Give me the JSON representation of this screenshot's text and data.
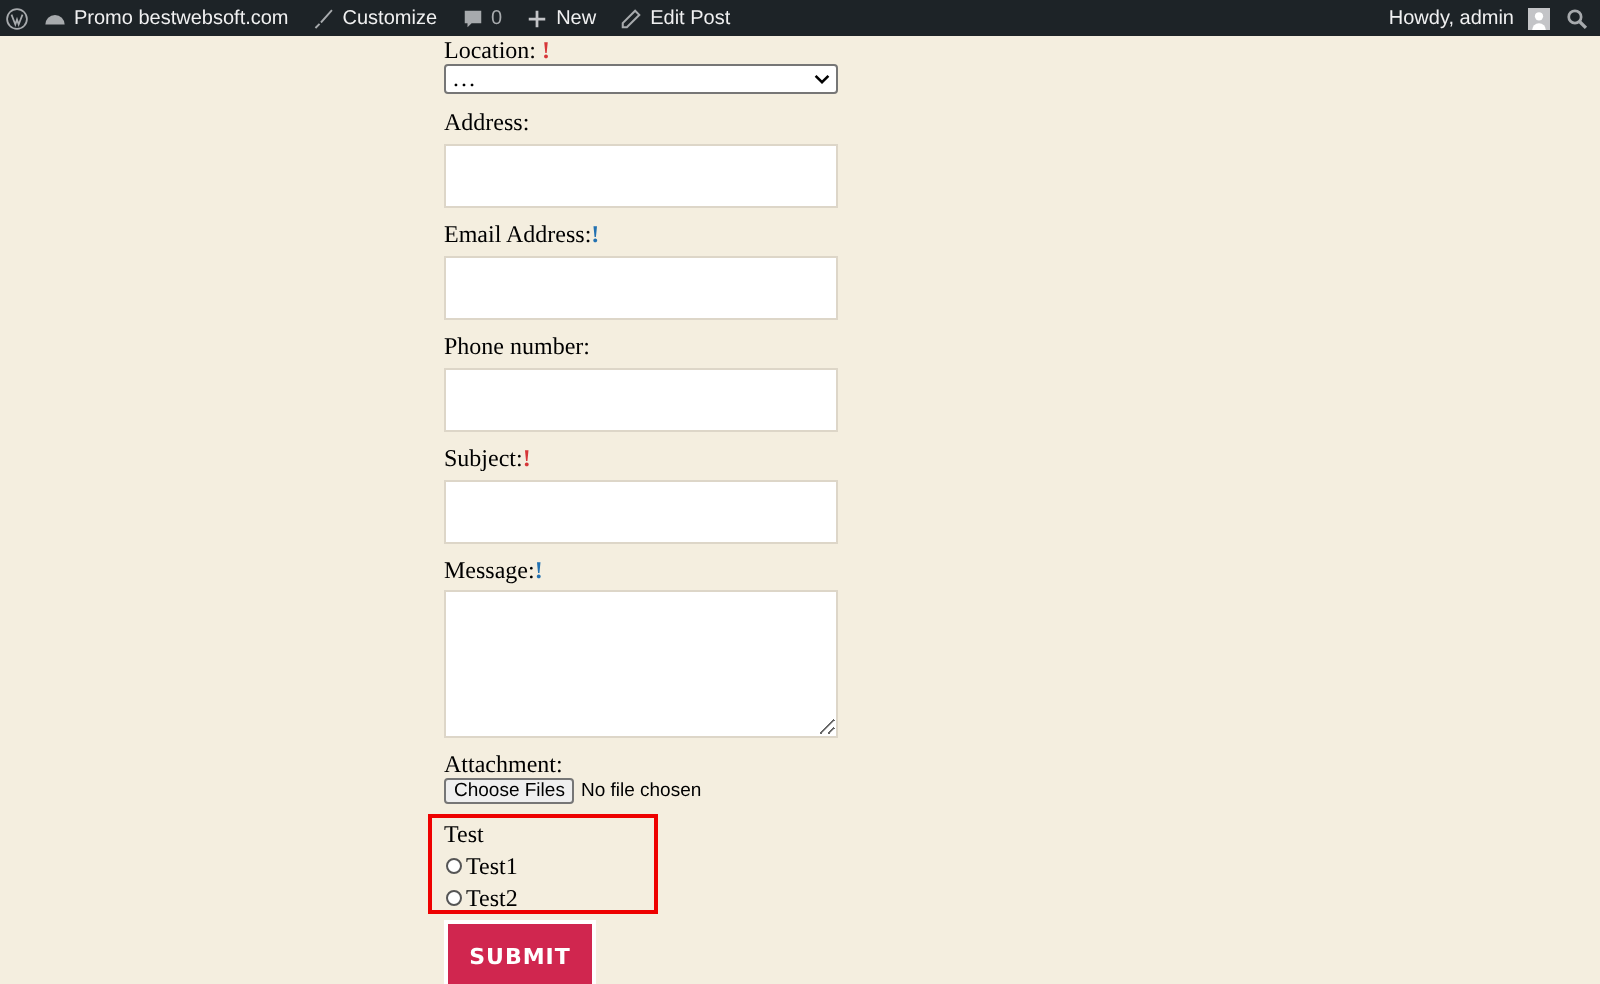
{
  "admin_bar": {
    "site": "Promo bestwebsoft.com",
    "customize": "Customize",
    "comments": "0",
    "new": "New",
    "edit": "Edit Post",
    "greeting": "Howdy, admin"
  },
  "form": {
    "location": {
      "label": "Location:",
      "mark": "!",
      "color": "#d63638",
      "value": "…"
    },
    "fields": [
      {
        "kind": "input",
        "label": "Address:"
      },
      {
        "kind": "input",
        "label": "Email Address:",
        "mark": "!",
        "color": "#2271b1"
      },
      {
        "kind": "input",
        "label": "Phone number:"
      },
      {
        "kind": "input",
        "label": "Subject:",
        "mark": "!",
        "color": "#d63638"
      },
      {
        "kind": "textarea",
        "label": "Message:",
        "mark": "!",
        "color": "#2271b1"
      }
    ],
    "attachment": {
      "label": "Attachment:",
      "button": "Choose Files",
      "status": "No file chosen"
    },
    "test": {
      "label": "Test",
      "options": [
        {
          "label": "Test1",
          "selected": false
        },
        {
          "label": "Test2",
          "selected": false
        }
      ]
    },
    "submit": "SUBMIT"
  }
}
